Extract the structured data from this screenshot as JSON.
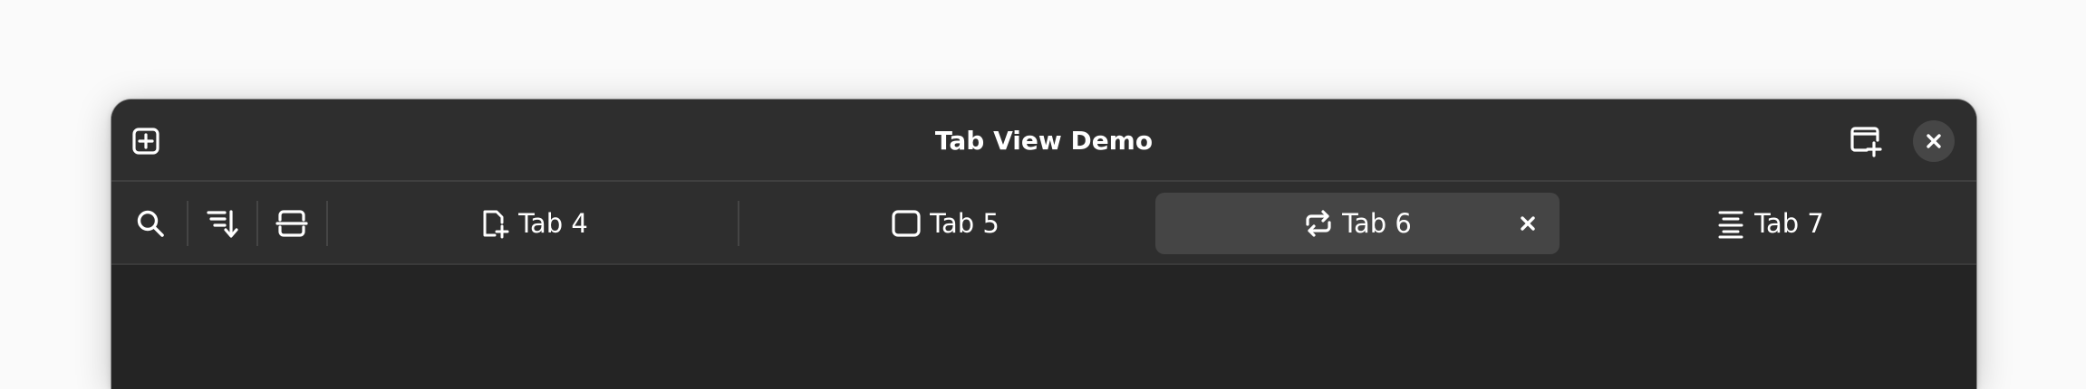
{
  "window": {
    "title": "Tab View Demo"
  },
  "headerbar": {
    "left_button_icon": "tab-new-icon",
    "right_button_icon": "window-new-icon",
    "close_icon": "window-close-icon"
  },
  "tabbar": {
    "start_actions": [
      {
        "icon": "search-icon"
      },
      {
        "icon": "sort-descending-icon"
      },
      {
        "icon": "tab-overview-icon"
      }
    ],
    "tabs": [
      {
        "label": "Tab 4",
        "icon": "document-new-icon",
        "selected": false
      },
      {
        "label": "Tab 5",
        "icon": "square-icon",
        "selected": false
      },
      {
        "label": "Tab 6",
        "icon": "repeat-icon",
        "selected": true,
        "close_icon": "close-icon"
      },
      {
        "label": "Tab 7",
        "icon": "justify-text-icon",
        "selected": false
      }
    ]
  },
  "colors": {
    "background": "#fafafa",
    "window": "#242424",
    "headerbar": "#2e2e2e",
    "selected_tab": "#454545",
    "text": "#ffffff"
  }
}
